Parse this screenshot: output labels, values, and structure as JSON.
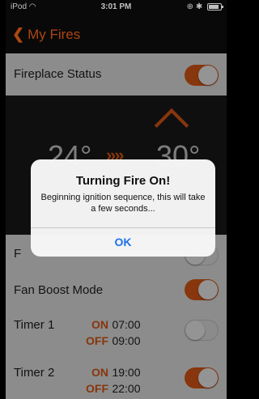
{
  "status_bar": {
    "carrier": "iPod",
    "wifi_icon": "wifi-icon",
    "time": "3:01 PM",
    "right_icons": "⊕ ✱"
  },
  "nav": {
    "back_label": "My Fires"
  },
  "fireplace_status": {
    "label": "Fireplace Status",
    "toggle_on": true
  },
  "temperature": {
    "current": "24°",
    "target": "30°",
    "arrows": "»»"
  },
  "flame_row": {
    "label_partial": "F",
    "toggle_on": false
  },
  "fan_boost": {
    "label": "Fan Boost Mode",
    "toggle_on": true
  },
  "timers": [
    {
      "label": "Timer 1",
      "on_label": "ON",
      "on_time": "07:00",
      "off_label": "OFF",
      "off_time": "09:00",
      "toggle_on": false
    },
    {
      "label": "Timer 2",
      "on_label": "ON",
      "on_time": "19:00",
      "off_label": "OFF",
      "off_time": "22:00",
      "toggle_on": true
    }
  ],
  "alert": {
    "title": "Turning Fire On!",
    "message": "Beginning ignition sequence, this will take a few seconds...",
    "ok_label": "OK"
  },
  "colors": {
    "accent": "#e85e18",
    "alert_button": "#1a73e8"
  }
}
